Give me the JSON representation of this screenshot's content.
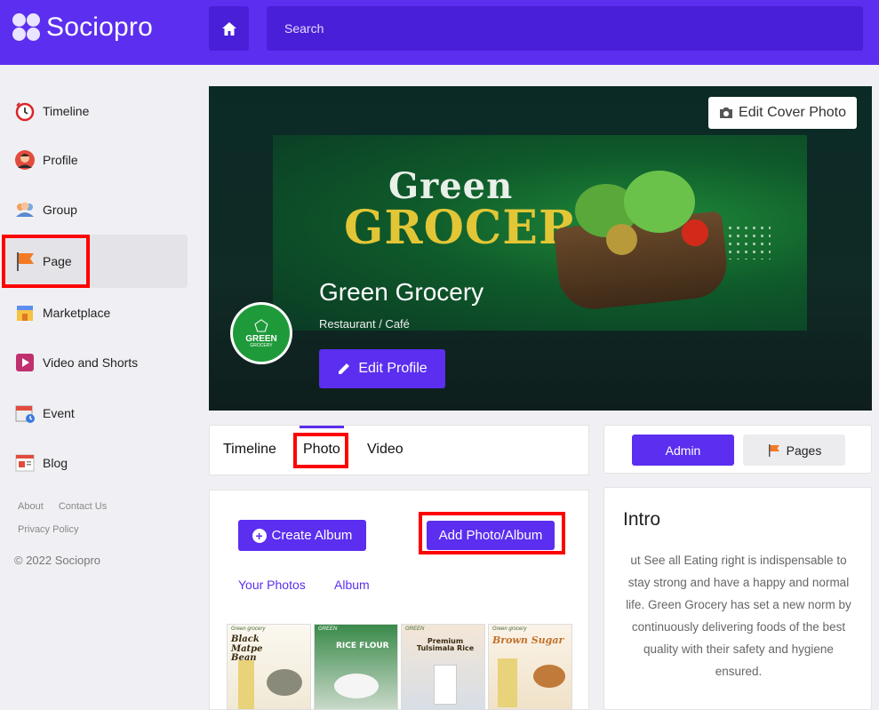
{
  "header": {
    "app_name": "Sociopro",
    "search_placeholder": "Search"
  },
  "sidebar": {
    "items": [
      {
        "label": "Timeline"
      },
      {
        "label": "Profile"
      },
      {
        "label": "Group"
      },
      {
        "label": "Page"
      },
      {
        "label": "Marketplace"
      },
      {
        "label": "Video and Shorts"
      },
      {
        "label": "Event"
      },
      {
        "label": "Blog"
      }
    ],
    "footer_links": [
      "About",
      "Contact Us",
      "Privacy Policy"
    ],
    "copyright": "© 2022 Sociopro"
  },
  "cover": {
    "edit_cover_label": "Edit Cover Photo",
    "banner_line1": "Green",
    "banner_line2": "GROCERY",
    "page_name": "Green Grocery",
    "category": "Restaurant / Café",
    "edit_profile_label": "Edit Profile",
    "avatar_text": "GREEN",
    "avatar_sub": "GROCERY"
  },
  "tabs": [
    "Timeline",
    "Photo",
    "Video"
  ],
  "side_tabs": {
    "admin_label": "Admin",
    "pages_label": "Pages"
  },
  "album": {
    "create_album_label": "Create Album",
    "add_photo_label": "Add Photo/Album",
    "your_photos_label": "Your Photos",
    "album_label": "Album",
    "photos": [
      {
        "brand": "Green grocery",
        "title": "Black Matpe Bean"
      },
      {
        "brand": "GREEN",
        "title": "RICE FLOUR"
      },
      {
        "brand": "GREEN",
        "title": "Premium Tulsimala Rice"
      },
      {
        "brand": "Green grocery",
        "title": "Brown Sugar"
      }
    ]
  },
  "intro": {
    "title": "Intro",
    "text": "ut See all Eating right is indispensable to stay strong and have a happy and normal life. Green Grocery has set a new norm by continuously delivering foods of the best quality with their safety and hygiene ensured."
  },
  "colors": {
    "accent": "#5b2ef0",
    "highlight": "#ff0000"
  }
}
